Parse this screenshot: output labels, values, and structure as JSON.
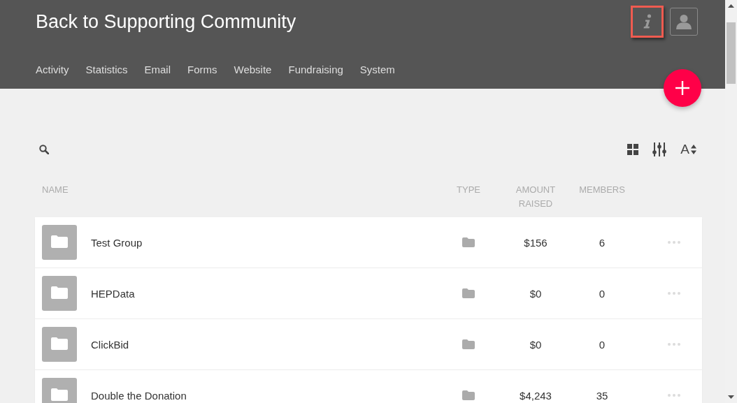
{
  "header": {
    "title": "Back to Supporting Community",
    "info_button": {
      "highlighted": true
    },
    "nav": [
      {
        "label": "Activity",
        "selected": false
      },
      {
        "label": "Statistics",
        "selected": false
      },
      {
        "label": "Email",
        "selected": false
      },
      {
        "label": "Forms",
        "selected": false
      },
      {
        "label": "Website",
        "selected": false
      },
      {
        "label": "Fundraising",
        "selected": false
      },
      {
        "label": "System",
        "selected": false
      }
    ]
  },
  "toolbar": {
    "sort_button": {
      "label": "A"
    }
  },
  "table": {
    "columns": [
      "NAME",
      "TYPE",
      "AMOUNT RAISED",
      "MEMBERS"
    ],
    "rows": [
      {
        "kind": "folder",
        "name": "Test Group",
        "amount_raised": "$156",
        "members": "6"
      },
      {
        "kind": "folder",
        "name": "HEPData",
        "amount_raised": "$0",
        "members": "0"
      },
      {
        "kind": "folder",
        "name": "ClickBid",
        "amount_raised": "$0",
        "members": "0"
      },
      {
        "kind": "folder",
        "name": "Double the Donation",
        "amount_raised": "$4,243",
        "members": "35"
      }
    ]
  }
}
